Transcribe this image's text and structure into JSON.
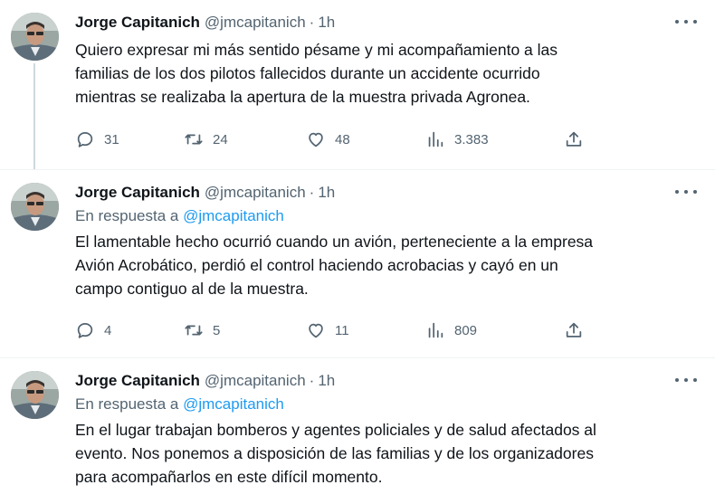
{
  "colors": {
    "text": "#0f1419",
    "secondary": "#536471",
    "link": "#1d9bf0",
    "divider": "#eff3f4",
    "thread_line": "#cfd9de"
  },
  "tweets": [
    {
      "author": {
        "name": "Jorge Capitanich",
        "handle": "@jmcapitanich",
        "time": "1h",
        "separator": "·"
      },
      "text": "Quiero expresar mi más sentido pésame y mi acompañamiento a las\nfamilias de los dos pilotos fallecidos durante un accidente ocurrido\nmientras se realizaba la apertura de la muestra privada Agronea.",
      "stats": {
        "replies": "31",
        "retweets": "24",
        "likes": "48",
        "views": "3.383"
      }
    },
    {
      "author": {
        "name": "Jorge Capitanich",
        "handle": "@jmcapitanich",
        "time": "1h",
        "separator": "·"
      },
      "reply_to": {
        "prefix": "En respuesta a",
        "mention": "@jmcapitanich"
      },
      "text": "El lamentable hecho ocurrió cuando un avión, perteneciente a la empresa\nAvión Acrobático, perdió el control haciendo acrobacias y cayó en un\ncampo contiguo al de la muestra.",
      "stats": {
        "replies": "4",
        "retweets": "5",
        "likes": "11",
        "views": "809"
      }
    },
    {
      "author": {
        "name": "Jorge Capitanich",
        "handle": "@jmcapitanich",
        "time": "1h",
        "separator": "·"
      },
      "reply_to": {
        "prefix": "En respuesta a",
        "mention": "@jmcapitanich"
      },
      "text": "En el lugar trabajan bomberos y agentes policiales y de salud afectados al\nevento. Nos ponemos a disposición de las familias y de los organizadores\npara acompañarlos en este difícil momento."
    }
  ],
  "icons": {
    "reply": "reply-icon",
    "retweet": "retweet-icon",
    "like": "heart-icon",
    "views": "views-icon",
    "share": "share-icon",
    "more": "more-icon"
  }
}
